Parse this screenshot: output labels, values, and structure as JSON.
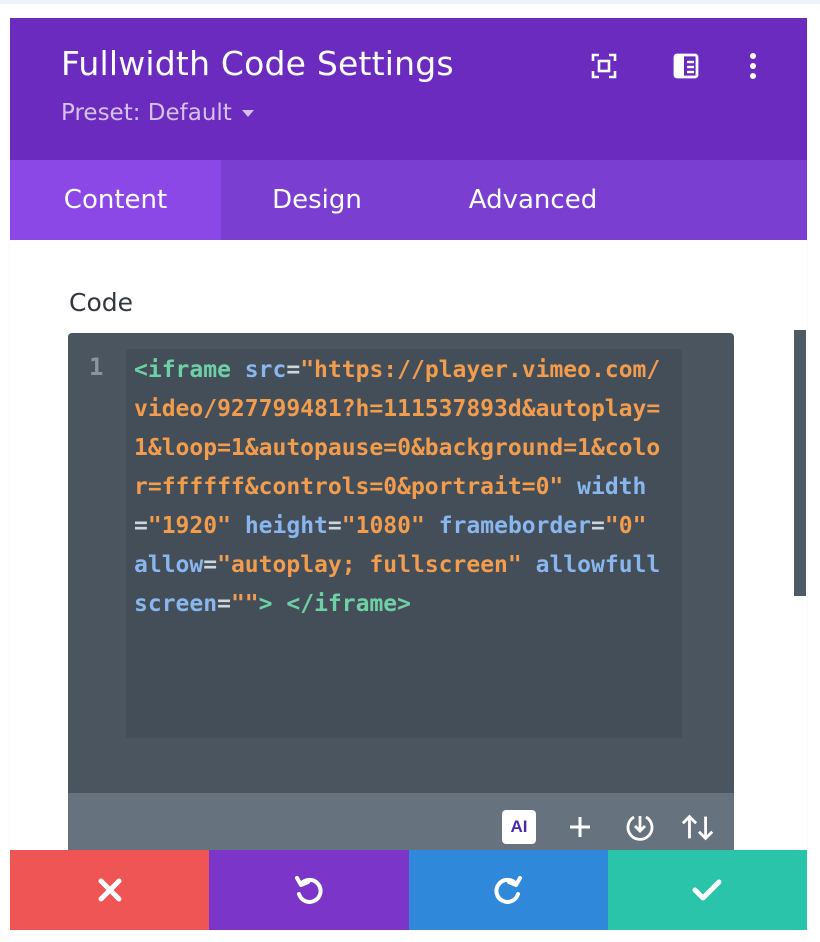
{
  "panel": {
    "title": "Fullwidth Code Settings",
    "preset_label": "Preset: Default"
  },
  "header_icons": [
    "expand-icon",
    "split-view-icon",
    "more-vertical-icon"
  ],
  "tabs": [
    {
      "label": "Content",
      "active": true
    },
    {
      "label": "Design",
      "active": false
    },
    {
      "label": "Advanced",
      "active": false
    }
  ],
  "code_field": {
    "label": "Code",
    "line_number": "1",
    "tokens": [
      {
        "t": "tag",
        "v": "<iframe"
      },
      {
        "t": "sp",
        "v": " "
      },
      {
        "t": "attr",
        "v": "src"
      },
      {
        "t": "eq",
        "v": "="
      },
      {
        "t": "str",
        "v": "\"https://player.vimeo.com/video/927799481?h=111537893d&autoplay=1&loop=1&autopause=0&background=1&color=ffffff&controls=0&portrait=0\""
      },
      {
        "t": "sp",
        "v": " "
      },
      {
        "t": "attr",
        "v": "width"
      },
      {
        "t": "eq",
        "v": "="
      },
      {
        "t": "str",
        "v": "\"1920\""
      },
      {
        "t": "sp",
        "v": " "
      },
      {
        "t": "attr",
        "v": "height"
      },
      {
        "t": "eq",
        "v": "="
      },
      {
        "t": "str",
        "v": "\"1080\""
      },
      {
        "t": "sp",
        "v": " "
      },
      {
        "t": "attr",
        "v": "frameborder"
      },
      {
        "t": "eq",
        "v": "="
      },
      {
        "t": "str",
        "v": "\"0\""
      },
      {
        "t": "sp",
        "v": " "
      },
      {
        "t": "attr",
        "v": "allow"
      },
      {
        "t": "eq",
        "v": "="
      },
      {
        "t": "str",
        "v": "\"autoplay; fullscreen\""
      },
      {
        "t": "sp",
        "v": " "
      },
      {
        "t": "attr",
        "v": "allowfullscreen"
      },
      {
        "t": "eq",
        "v": "="
      },
      {
        "t": "str",
        "v": "\"\""
      },
      {
        "t": "tag",
        "v": ">"
      },
      {
        "t": "sp",
        "v": " "
      },
      {
        "t": "tag",
        "v": "</iframe>"
      }
    ]
  },
  "editor_toolbar": {
    "ai_label": "AI",
    "icons": [
      "ai-icon",
      "plus-icon",
      "download-icon",
      "sort-icon"
    ]
  },
  "footer_buttons": [
    {
      "name": "cancel-button",
      "icon": "close-icon",
      "color": "#ef5555"
    },
    {
      "name": "undo-button",
      "icon": "undo-icon",
      "color": "#7b35c8"
    },
    {
      "name": "redo-button",
      "icon": "redo-icon",
      "color": "#2f88d9"
    },
    {
      "name": "save-button",
      "icon": "check-icon",
      "color": "#29c4a9"
    }
  ],
  "colors": {
    "header": "#6b2bbf",
    "tabs": "#7a3fd0",
    "active_tab": "#8c48e6",
    "editor_bg": "#4a5560"
  }
}
